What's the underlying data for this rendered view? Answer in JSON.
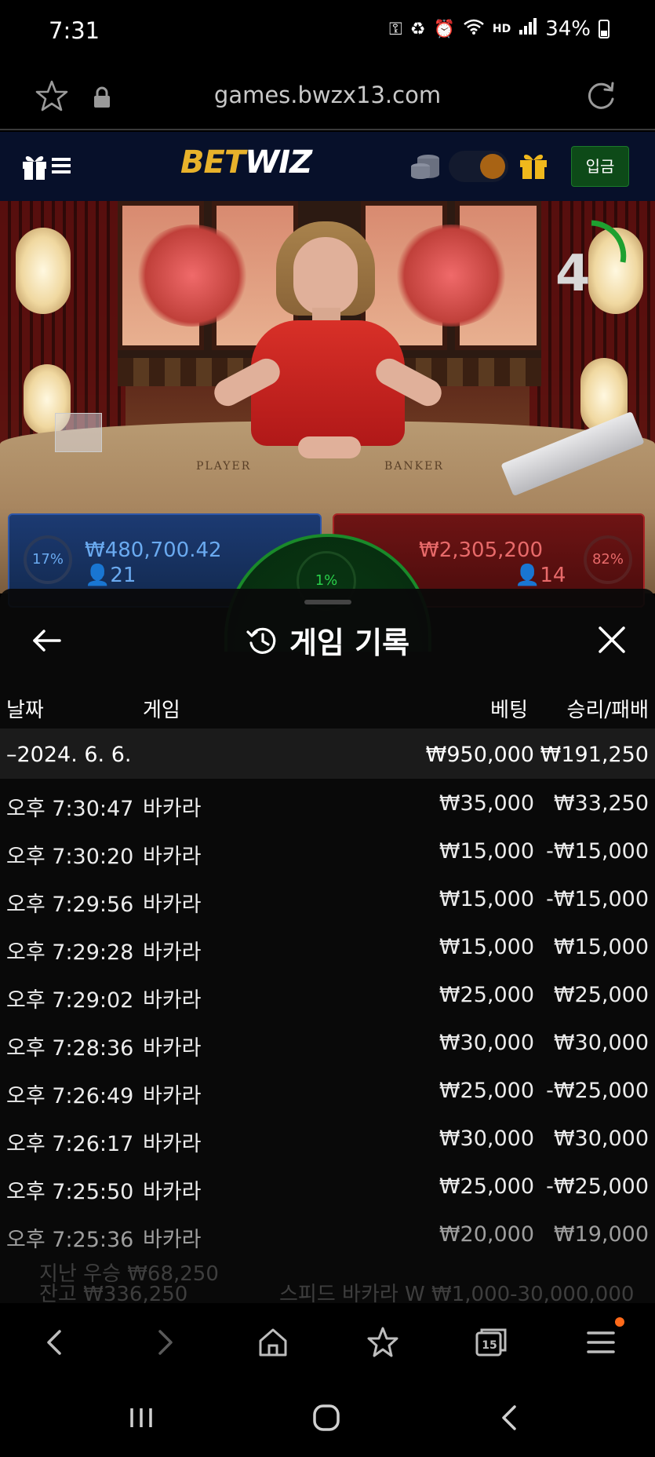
{
  "status_bar": {
    "time": "7:31",
    "network": "HD",
    "battery": "34%"
  },
  "browser": {
    "url": "games.bwzx13.com",
    "tab_count": "15",
    "notification_dot_color": "#ff6a1a"
  },
  "site_header": {
    "logo_bet": "BET",
    "logo_wiz": "WIZ",
    "deposit_label": "입금",
    "brand_colors": {
      "gold": "#e8b22b",
      "header_bg": "#07102a",
      "deposit_bg": "#0d4a18"
    }
  },
  "game": {
    "countdown": "4",
    "table_player_label": "PLAYER",
    "table_banker_label": "BANKER",
    "player": {
      "percent": "17%",
      "amount": "₩480,700.42",
      "users": "21"
    },
    "banker": {
      "percent": "82%",
      "amount": "₩2,305,200",
      "users": "14"
    },
    "tie": {
      "percent": "1%"
    }
  },
  "history_modal": {
    "title": "게임 기록",
    "columns": {
      "date": "날짜",
      "game": "게임",
      "bet": "베팅",
      "result": "승리/패배"
    },
    "summary": {
      "date": "–2024. 6. 6.",
      "bet": "₩950,000",
      "result": "₩191,250"
    },
    "rows": [
      {
        "time": "오후 7:30:47",
        "game": "바카라",
        "bet": "₩35,000",
        "result": "₩33,250"
      },
      {
        "time": "오후 7:30:20",
        "game": "바카라",
        "bet": "₩15,000",
        "result": "-₩15,000"
      },
      {
        "time": "오후 7:29:56",
        "game": "바카라",
        "bet": "₩15,000",
        "result": "-₩15,000"
      },
      {
        "time": "오후 7:29:28",
        "game": "바카라",
        "bet": "₩15,000",
        "result": "₩15,000"
      },
      {
        "time": "오후 7:29:02",
        "game": "바카라",
        "bet": "₩25,000",
        "result": "₩25,000"
      },
      {
        "time": "오후 7:28:36",
        "game": "바카라",
        "bet": "₩30,000",
        "result": "₩30,000"
      },
      {
        "time": "오후 7:26:49",
        "game": "바카라",
        "bet": "₩25,000",
        "result": "-₩25,000"
      },
      {
        "time": "오후 7:26:17",
        "game": "바카라",
        "bet": "₩30,000",
        "result": "₩30,000"
      },
      {
        "time": "오후 7:25:50",
        "game": "바카라",
        "bet": "₩25,000",
        "result": "-₩25,000"
      },
      {
        "time": "오후 7:25:36",
        "game": "바카라",
        "bet": "₩20,000",
        "result": "₩19,000"
      }
    ],
    "background_ghost": {
      "last_win": "지난 우승 ₩68,250",
      "balance": "잔고 ₩336,250",
      "table_name": "스피드 바카라 W  ₩1,000-30,000,000"
    }
  }
}
